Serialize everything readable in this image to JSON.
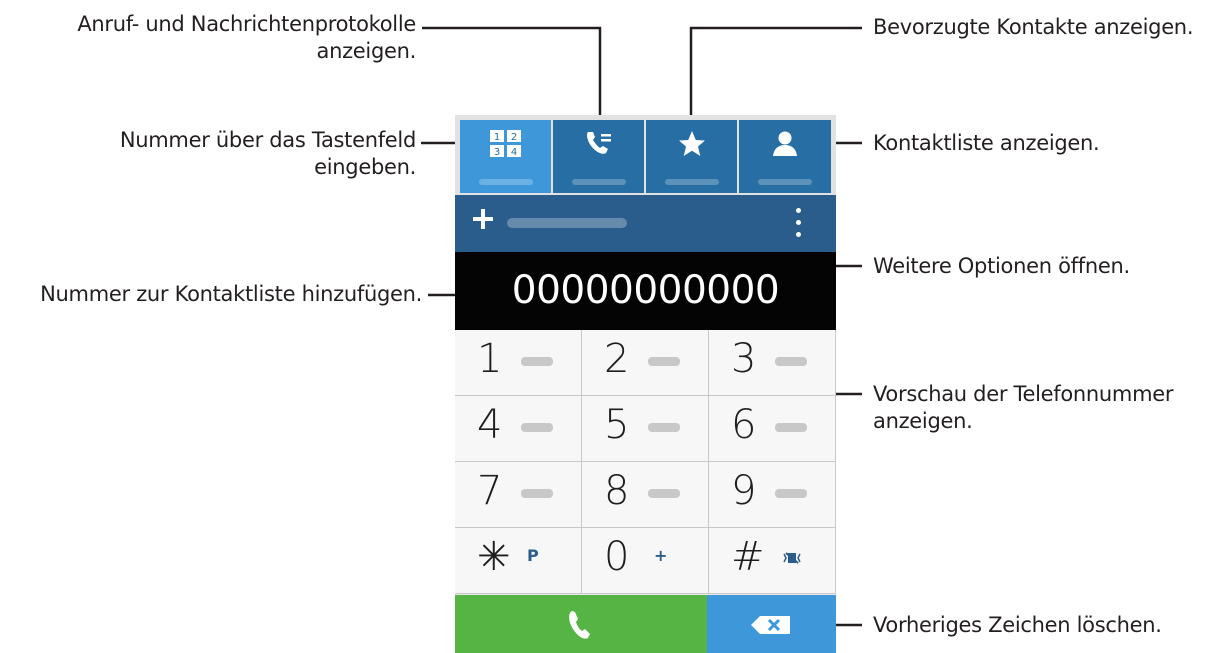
{
  "callouts": {
    "logs": [
      "Anruf- und Nachrichtenprotokolle",
      "anzeigen."
    ],
    "favorites": "Bevorzugte Kontakte anzeigen.",
    "keypad": [
      "Nummer über das Tastenfeld",
      "eingeben."
    ],
    "contacts": "Kontaktliste anzeigen.",
    "more_options": "Weitere Optionen öffnen.",
    "add_contact": "Nummer zur Kontaktliste hinzufügen.",
    "preview": [
      "Vorschau der Telefonnummer",
      "anzeigen."
    ],
    "delete": "Vorheriges Zeichen löschen."
  },
  "tabs": [
    {
      "icon": "keypad-icon",
      "active": true
    },
    {
      "icon": "call-log-icon",
      "active": false
    },
    {
      "icon": "star-icon",
      "active": false
    },
    {
      "icon": "contact-person-icon",
      "active": false
    }
  ],
  "topbar": {
    "add_icon": "plus-icon",
    "menu_icon": "more-options-icon"
  },
  "display": {
    "number": "00000000000"
  },
  "keys": [
    {
      "digit": "1",
      "sub": ""
    },
    {
      "digit": "2",
      "sub": ""
    },
    {
      "digit": "3",
      "sub": ""
    },
    {
      "digit": "4",
      "sub": ""
    },
    {
      "digit": "5",
      "sub": ""
    },
    {
      "digit": "6",
      "sub": ""
    },
    {
      "digit": "7",
      "sub": ""
    },
    {
      "digit": "8",
      "sub": ""
    },
    {
      "digit": "9",
      "sub": ""
    },
    {
      "digit": "✳",
      "sub": "P"
    },
    {
      "digit": "0",
      "sub": "+"
    },
    {
      "digit": "#",
      "sub": ""
    }
  ],
  "buttons": {
    "call_icon": "phone-icon",
    "delete_icon": "backspace-icon"
  },
  "colors": {
    "tab_active": "#3d97d9",
    "tab": "#266ea3",
    "topbar": "#2b5d8c",
    "call": "#55b443",
    "delete": "#3d97d9"
  }
}
